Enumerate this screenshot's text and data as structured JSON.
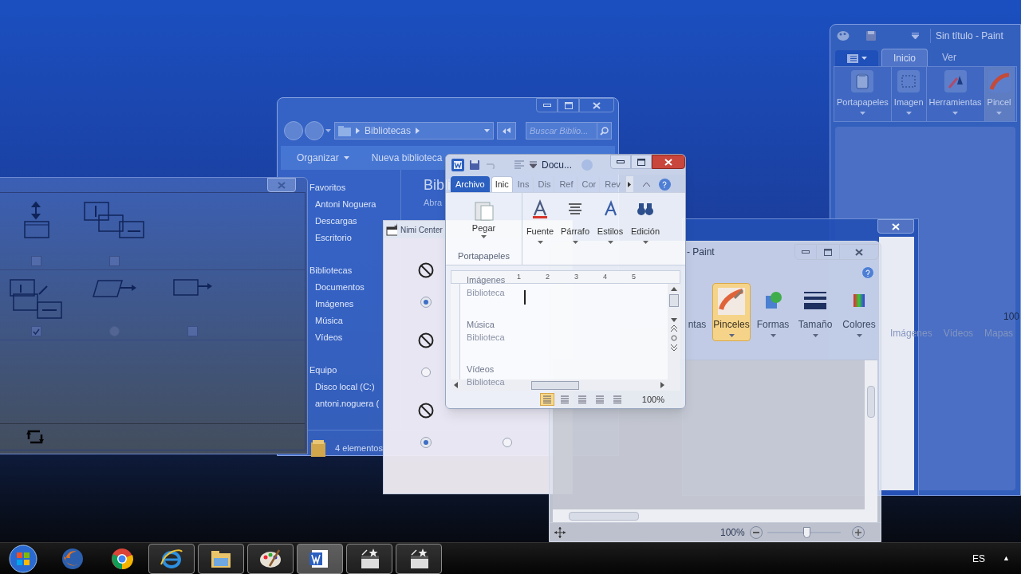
{
  "paint_back": {
    "title": "Sin título - Paint",
    "tabs": [
      {
        "label": "Inicio",
        "selected": true
      },
      {
        "label": "Ver",
        "selected": false
      }
    ],
    "groups": [
      "Portapapeles",
      "Imagen",
      "Herramientas",
      "Pincel"
    ]
  },
  "browser": {
    "links": [
      "Imágenes",
      "Vídeos",
      "Mapas"
    ],
    "zoom": "100"
  },
  "explorer": {
    "address": "Bibliotecas",
    "search_placeholder": "Buscar Biblio...",
    "toolbar": [
      "Organizar",
      "Nueva biblioteca"
    ],
    "sidebar": [
      {
        "label": "Favoritos",
        "children": [
          {
            "label": "Antoni Noguera"
          },
          {
            "label": "Descargas"
          },
          {
            "label": "Escritorio"
          }
        ]
      },
      {
        "label": "Bibliotecas",
        "children": [
          {
            "label": "Documentos"
          },
          {
            "label": "Imágenes"
          },
          {
            "label": "Música"
          },
          {
            "label": "Vídeos"
          }
        ]
      },
      {
        "label": "Equipo",
        "children": [
          {
            "label": "Disco local (C:)"
          },
          {
            "label": "antoni.noguera ("
          }
        ]
      }
    ],
    "heading": "Bibli",
    "subtitle": "Abra",
    "libraries": [
      {
        "name": "Imágenes",
        "type": "Biblioteca"
      },
      {
        "name": "Música",
        "type": "Biblioteca"
      },
      {
        "name": "Vídeos",
        "type": "Biblioteca"
      }
    ],
    "status": "4 elementos"
  },
  "options_window": {
    "rows": [
      [
        {
          "kind": "checkbox",
          "checked": false
        },
        {
          "kind": "checkbox",
          "checked": false
        }
      ],
      [
        {
          "kind": "checkbox",
          "checked": true
        },
        {
          "kind": "radio",
          "selected": false
        },
        {
          "kind": "checkbox",
          "checked": false
        }
      ]
    ]
  },
  "nimi_center": {
    "title": "Nimi Center",
    "rows": [
      [
        {
          "selected": true
        }
      ],
      [
        {
          "selected": false
        }
      ],
      [
        {
          "selected": true
        },
        {
          "selected": false
        }
      ]
    ]
  },
  "paint_front": {
    "title": "- Paint",
    "groups": [
      {
        "label": "ntas",
        "selected": false
      },
      {
        "label": "Pinceles",
        "selected": true
      },
      {
        "label": "Formas",
        "selected": false
      },
      {
        "label": "Tamaño",
        "selected": false
      },
      {
        "label": "Colores",
        "selected": false
      }
    ],
    "zoom": "100%",
    "level": 0.55
  },
  "word": {
    "title": "Docu...",
    "tabs": [
      {
        "label": "Archivo",
        "kind": "file",
        "selected": false
      },
      {
        "label": "Inic",
        "kind": "tab",
        "selected": true
      },
      {
        "label": "Ins",
        "kind": "tab",
        "selected": false
      },
      {
        "label": "Dis",
        "kind": "tab",
        "selected": false
      },
      {
        "label": "Ref",
        "kind": "tab",
        "selected": false
      },
      {
        "label": "Cor",
        "kind": "tab",
        "selected": false
      },
      {
        "label": "Rev",
        "kind": "tab",
        "selected": false
      }
    ],
    "paste": "Pegar",
    "clipboard": "Portapapeles",
    "groups": [
      "Fuente",
      "Párrafo",
      "Estilos",
      "Edición"
    ],
    "ruler": [
      "1",
      "2",
      "3",
      "4",
      "5"
    ],
    "zoom": "100%"
  },
  "taskbar": {
    "apps": [
      {
        "kind": "firefox",
        "running": false,
        "selected": false
      },
      {
        "kind": "chrome",
        "running": false,
        "selected": false
      },
      {
        "kind": "ie",
        "running": true,
        "selected": false
      },
      {
        "kind": "explorer",
        "running": true,
        "selected": false
      },
      {
        "kind": "paint",
        "running": true,
        "selected": false
      },
      {
        "kind": "word",
        "running": true,
        "selected": true
      },
      {
        "kind": "movie",
        "running": true,
        "selected": false
      },
      {
        "kind": "movie",
        "running": true,
        "selected": false
      }
    ],
    "language": "ES",
    "tray_arrow": "▲"
  }
}
